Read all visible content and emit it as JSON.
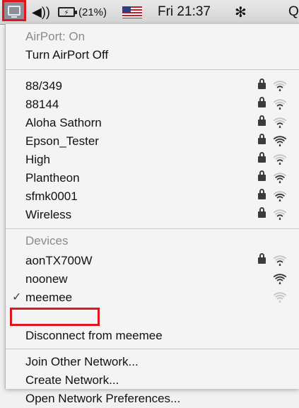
{
  "menubar": {
    "airport_icon": "airport-icon",
    "volume_icon": "speaker-volume-icon",
    "volume_glyph": "◀︎))",
    "battery_icon": "battery-icon",
    "battery_percent": "(21%)",
    "flag_icon": "us-flag-icon",
    "clock": "Fri 21:37",
    "bluetooth_icon": "bluetooth-icon",
    "bluetooth_glyph": "✻",
    "spotlight_icon": "spotlight-search-icon",
    "spotlight_glyph": "Q"
  },
  "menu": {
    "status": "AirPort: On",
    "toggle": "Turn AirPort Off",
    "networks": [
      {
        "name": "88/349",
        "locked": true,
        "strength": 1
      },
      {
        "name": "88144",
        "locked": true,
        "strength": 1
      },
      {
        "name": "Aloha Sathorn",
        "locked": true,
        "strength": 1
      },
      {
        "name": "Epson_Tester",
        "locked": true,
        "strength": 3
      },
      {
        "name": "High",
        "locked": true,
        "strength": 1
      },
      {
        "name": "Plantheon",
        "locked": true,
        "strength": 2
      },
      {
        "name": "sfmk0001",
        "locked": true,
        "strength": 2
      },
      {
        "name": "Wireless",
        "locked": true,
        "strength": 1
      }
    ],
    "devices_header": "Devices",
    "devices": [
      {
        "name": "aonTX700W",
        "locked": true,
        "strength": 1,
        "checked": false
      },
      {
        "name": "noonew",
        "locked": false,
        "strength": 3,
        "checked": false
      },
      {
        "name": "meemee",
        "locked": false,
        "strength": 0,
        "checked": true
      }
    ],
    "disconnect": "Disconnect from meemee",
    "check_glyph": "✓",
    "actions": [
      "Join Other Network...",
      "Create Network...",
      "Open Network Preferences..."
    ]
  },
  "colors": {
    "highlight": "#e0161f",
    "menubar": "#d8d8d8",
    "menu_bg": "#f4f4f4",
    "dim_text": "#8a8a8a"
  }
}
